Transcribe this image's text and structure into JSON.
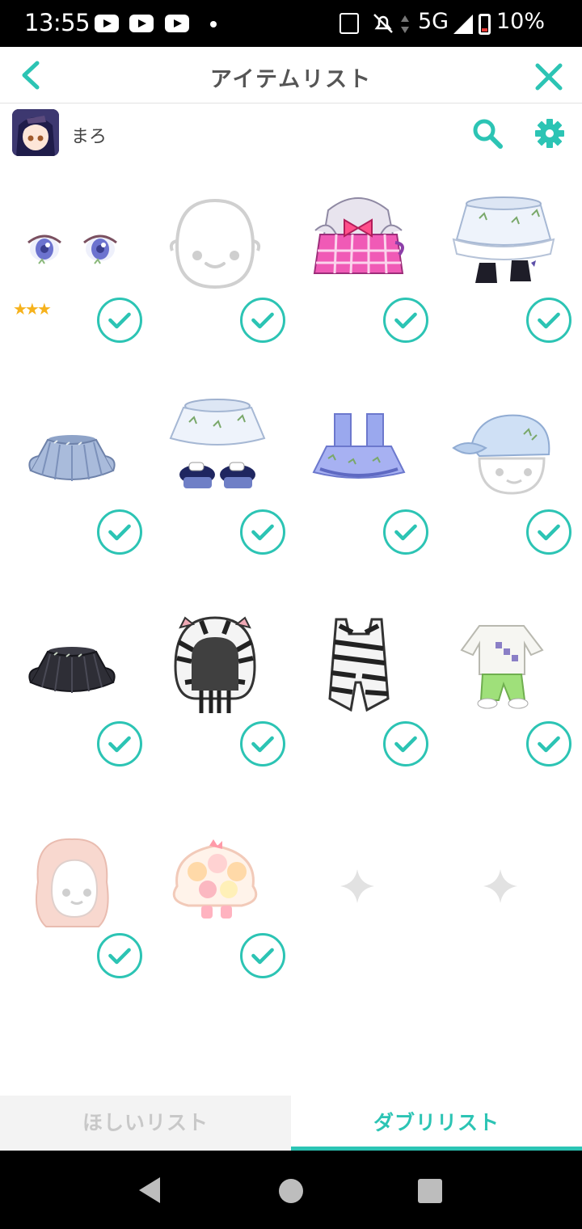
{
  "status_bar": {
    "time": "13:55",
    "network": "5G",
    "battery": "10%"
  },
  "header": {
    "title": "アイテムリスト"
  },
  "user": {
    "name": "まろ"
  },
  "items": [
    {
      "name": "eyes",
      "stars": "★★★",
      "checked": true
    },
    {
      "name": "face-base",
      "checked": true
    },
    {
      "name": "pink-plaid-outfit",
      "checked": true
    },
    {
      "name": "white-floral-skirt-boots",
      "checked": true
    },
    {
      "name": "blue-pleated-skirt",
      "checked": true
    },
    {
      "name": "floral-skirt-sandals",
      "checked": true
    },
    {
      "name": "blue-tulle-dress",
      "checked": true
    },
    {
      "name": "blue-casquette-hat",
      "checked": true
    },
    {
      "name": "black-pleated-skirt",
      "checked": true
    },
    {
      "name": "zebra-hood",
      "checked": true
    },
    {
      "name": "zebra-overalls",
      "checked": true
    },
    {
      "name": "white-shirt-green-pants",
      "checked": true
    },
    {
      "name": "peach-long-hair",
      "checked": true
    },
    {
      "name": "cake-dress",
      "checked": true
    },
    {
      "name": "empty-slot",
      "checked": false
    },
    {
      "name": "empty-slot",
      "checked": false
    }
  ],
  "tabs": {
    "want_list": "ほしいリスト",
    "dup_list": "ダブリリスト",
    "active": "dup_list"
  },
  "colors": {
    "accent": "#2cc4b4",
    "inactive_tab_bg": "#f3f3f3"
  }
}
